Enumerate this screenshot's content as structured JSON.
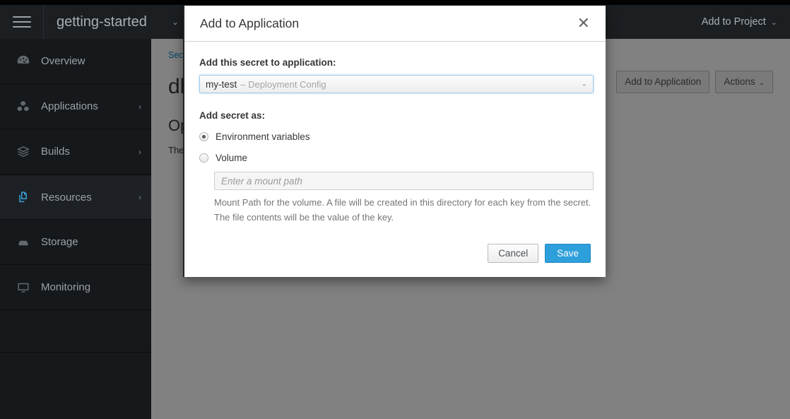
{
  "navbar": {
    "hamburger_icon": "hamburger-menu-icon",
    "project_name": "getting-started",
    "project_caret": "⌄",
    "add_to_project_label": "Add to Project",
    "add_to_project_caret": "⌄"
  },
  "sidebar": {
    "items": [
      {
        "label": "Overview",
        "icon": "dashboard-icon",
        "has_chevron": false,
        "active": false
      },
      {
        "label": "Applications",
        "icon": "cubes-icon",
        "has_chevron": true,
        "active": false
      },
      {
        "label": "Builds",
        "icon": "layers-icon",
        "has_chevron": true,
        "active": false
      },
      {
        "label": "Resources",
        "icon": "resources-icon",
        "has_chevron": true,
        "active": true
      },
      {
        "label": "Storage",
        "icon": "storage-icon",
        "has_chevron": false,
        "active": false
      },
      {
        "label": "Monitoring",
        "icon": "monitor-icon",
        "has_chevron": false,
        "active": false
      }
    ],
    "chevron_glyph": "›"
  },
  "page": {
    "breadcrumb_first": "Secrets",
    "title": "dhc",
    "section_heading": "Options",
    "paragraph": "There are no options.",
    "actions": {
      "add_to_application": "Add to Application",
      "actions_label": "Actions",
      "actions_caret": "⌄"
    }
  },
  "modal": {
    "title": "Add to Application",
    "close_glyph": "✕",
    "close_icon": "close-icon",
    "application_label": "Add this secret to application:",
    "application_select": {
      "value_main": "my-test",
      "value_sub": "– Deployment Config",
      "caret": "⌄"
    },
    "secret_as_label": "Add secret as:",
    "options": [
      {
        "label": "Environment variables",
        "selected": true
      },
      {
        "label": "Volume",
        "selected": false
      }
    ],
    "mount_path": {
      "value": "",
      "placeholder": "Enter a mount path",
      "help": "Mount Path for the volume. A file will be created in this directory for each key from the secret. The file contents will be the value of the key."
    },
    "footer": {
      "cancel_label": "Cancel",
      "save_label": "Save"
    }
  },
  "colors": {
    "accent_blue": "#2d9fdb",
    "link_blue": "#0088ce",
    "sidebar_bg": "#16191c",
    "navbar_bg": "#1b1f22"
  }
}
